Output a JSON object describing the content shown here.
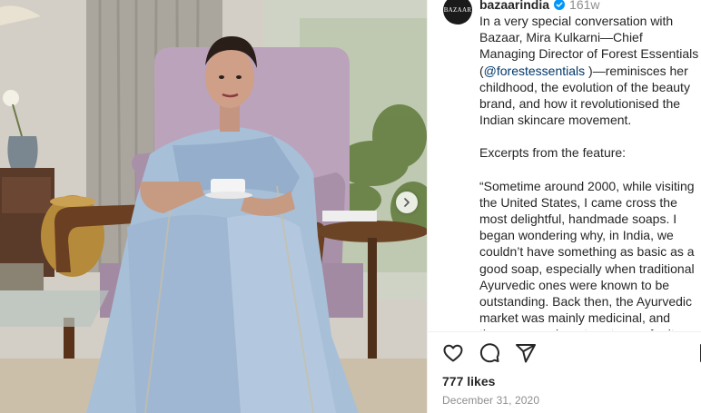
{
  "post": {
    "username": "bazaarindia",
    "avatar_text": "BAZAAR",
    "time_ago": "161w",
    "caption_p1_before": "In a very special conversation with Bazaar, Mira Kulkarni—Chief Managing Director of Forest Essentials (",
    "mention": "@forestessentials",
    "caption_p1_after": " )—reminisces her childhood, the evolution of the beauty brand, and how it revolutionised the Indian skincare movement.",
    "caption_p2": "Excerpts from the feature:",
    "caption_p3": "“Sometime around 2000, while visiting the United States, I came cross the most delightful, handmade soaps. I began wondering why, in India, we couldn’t have something as basic as a good soap, especially when traditional Ayurvedic ones were known to be outstanding. Back then, the Ayurvedic market was mainly medicinal, and there was no beauty category for it, so to",
    "likes": "777 likes",
    "date": "December 31, 2020"
  },
  "icons": {
    "verified": "verified-badge-icon",
    "like": "heart-icon",
    "comment": "comment-icon",
    "share": "paper-plane-icon",
    "save": "bookmark-icon",
    "next": "chevron-right-icon"
  },
  "colors": {
    "link": "#00376b",
    "muted": "#8e8e8e",
    "verified": "#0095f6",
    "text": "#262626"
  }
}
